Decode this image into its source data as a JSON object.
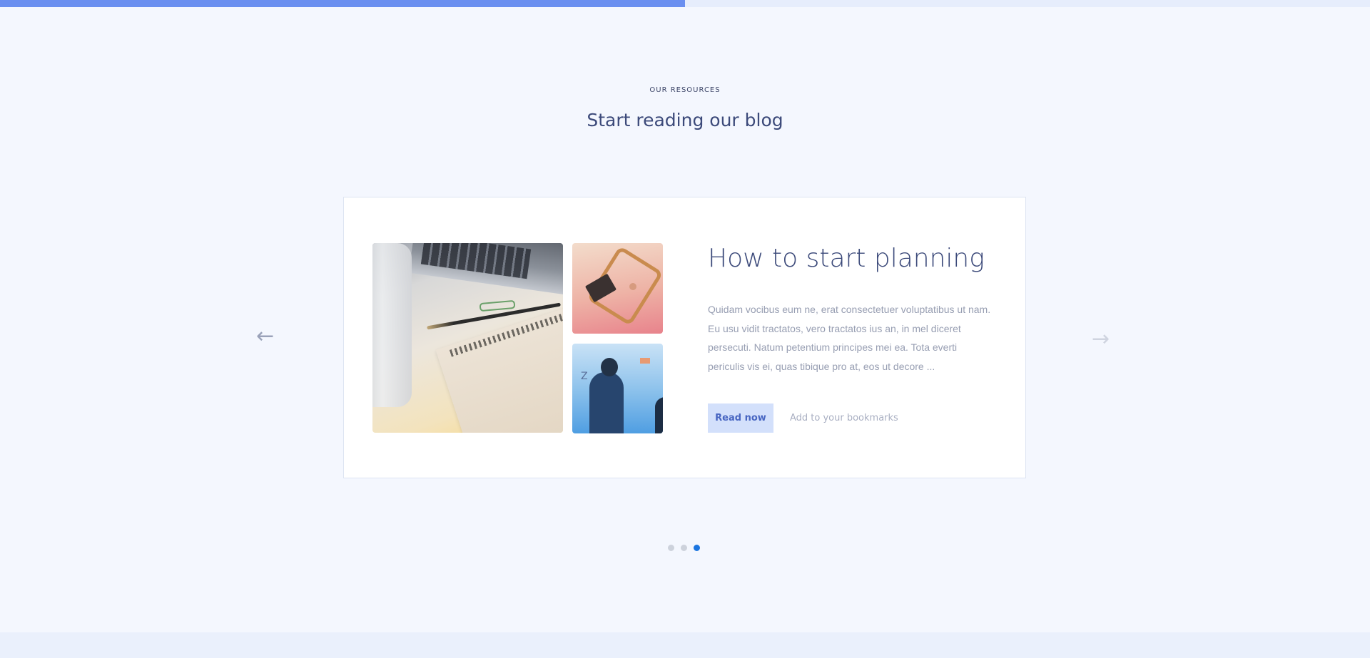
{
  "progress": {
    "fraction": 0.5,
    "fill_color": "#6a8ff0",
    "track_color": "#e6edfc"
  },
  "section": {
    "eyebrow": "OUR RESOURCES",
    "title": "Start reading our blog"
  },
  "post": {
    "title": "How to start planning",
    "excerpt": "Quidam vocibus eum ne, erat consectetuer voluptatibus ut nam. Eu usu vidit tractatos, vero tractatos ius an, in mel diceret persecuti. Natum petentium principes mei ea. Tota everti periculis vis ei, quas tibique pro at, eos ut decore ...",
    "read_label": "Read now",
    "bookmark_label": "Add to your bookmarks",
    "images": [
      "laptop-notebook-photo",
      "laptop-on-tray-photo",
      "whiteboard-meeting-photo"
    ]
  },
  "carousel": {
    "prev_icon": "arrow-left-icon",
    "next_icon": "arrow-right-icon",
    "prev_glyph": "←",
    "next_glyph": "→",
    "slide_count": 3,
    "active_index": 2,
    "active_color": "#1b75e0",
    "inactive_color": "#cdd2dc"
  }
}
